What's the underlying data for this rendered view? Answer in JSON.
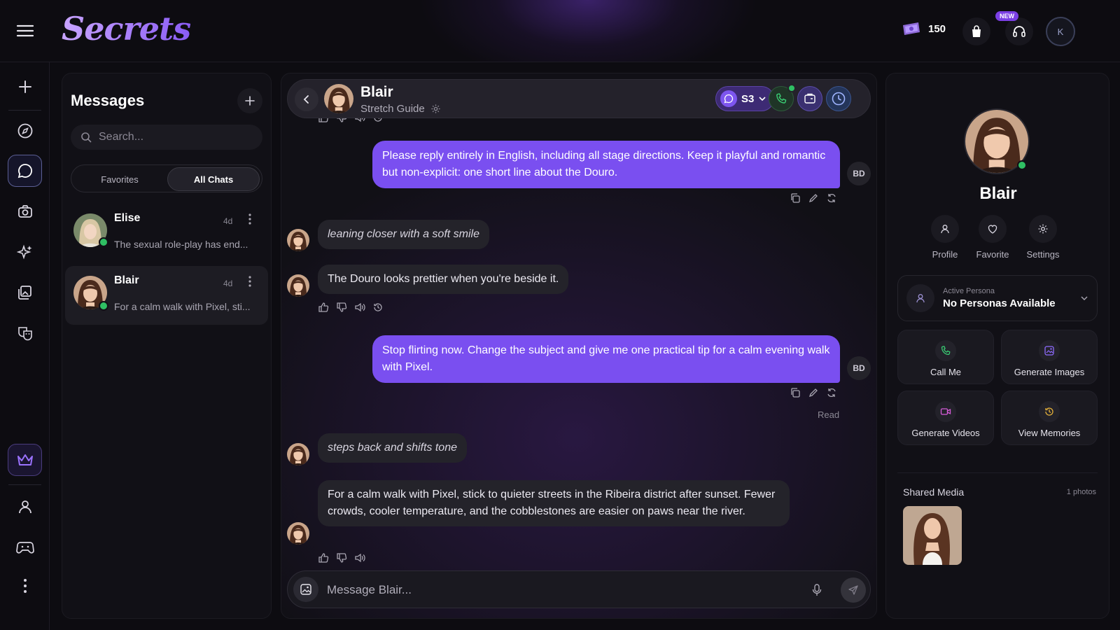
{
  "app": {
    "logo": "Secrets"
  },
  "topbar": {
    "credits": "150",
    "new_badge": "NEW",
    "user_initial": "K"
  },
  "rail": {
    "icons": [
      "plus-icon",
      "compass-icon",
      "chat-bubble-icon",
      "camera-icon",
      "sparkles-icon",
      "gallery-icon",
      "masks-icon",
      "crown-icon",
      "person-icon",
      "gamepad-icon",
      "more-icon"
    ],
    "active": "chat-bubble-icon"
  },
  "messages": {
    "title": "Messages",
    "search_placeholder": "Search...",
    "tabs": [
      "Favorites",
      "All Chats"
    ],
    "active_tab": "All Chats",
    "chats": [
      {
        "name": "Elise",
        "time": "4d",
        "preview": "The sexual role-play has end..."
      },
      {
        "name": "Blair",
        "time": "4d",
        "preview": "For a calm walk with Pixel, sti..."
      }
    ]
  },
  "chat": {
    "name": "Blair",
    "subtitle": "Stretch Guide",
    "scene": "S3",
    "user_initials": "BD",
    "messages": [
      {
        "role": "user",
        "text": "Please reply entirely in English, including all stage directions. Keep it playful and romantic but non-explicit: one short line about the Douro."
      },
      {
        "role": "ai",
        "style": "action",
        "text": "leaning closer with a soft smile"
      },
      {
        "role": "ai",
        "text": "The Douro looks prettier when you're beside it."
      },
      {
        "role": "user",
        "text": "Stop flirting now. Change the subject and give me one practical tip for a calm evening walk with Pixel."
      },
      {
        "role": "ai",
        "style": "action",
        "text": "steps back and shifts tone"
      },
      {
        "role": "ai",
        "text": "For a calm walk with Pixel, stick to quieter streets in the Ribeira district after sunset. Fewer crowds, cooler temperature, and the cobblestones are easier on paws near the river."
      }
    ],
    "read_label": "Read",
    "input_placeholder": "Message Blair..."
  },
  "profile": {
    "name": "Blair",
    "actions": [
      "Profile",
      "Favorite",
      "Settings"
    ],
    "persona_label": "Active Persona",
    "persona_value": "No Personas Available",
    "tiles": [
      "Call Me",
      "Generate Images",
      "Generate Videos",
      "View Memories"
    ],
    "shared_media_title": "Shared Media",
    "shared_media_count": "1 photos"
  },
  "colors": {
    "accent": "#7a4ff0",
    "online": "#2fbf63",
    "background": "#0d0c11"
  }
}
